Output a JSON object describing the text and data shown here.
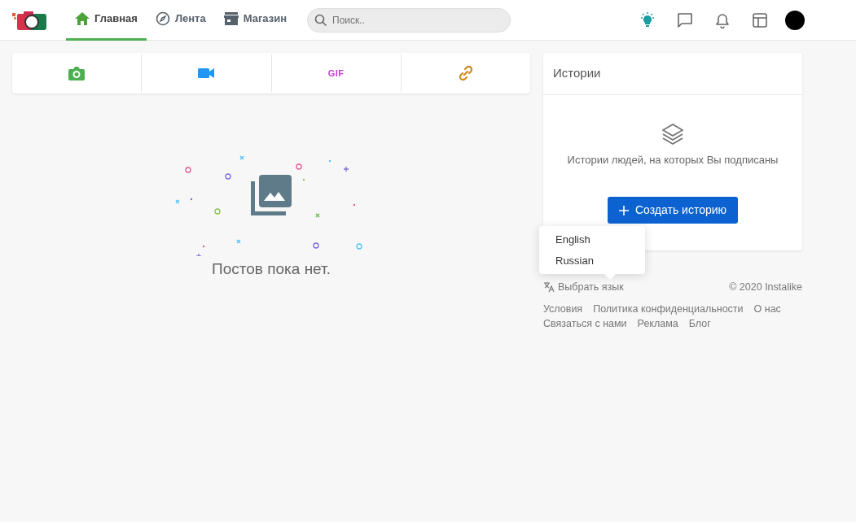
{
  "nav": {
    "tabs": [
      {
        "label": "Главная",
        "selected": true
      },
      {
        "label": "Лента",
        "selected": false
      },
      {
        "label": "Магазин",
        "selected": false
      }
    ],
    "search": {
      "placeholder": "Поиск.."
    }
  },
  "composer": [
    {
      "kind": "photo"
    },
    {
      "kind": "video"
    },
    {
      "kind": "gif",
      "label": "GIF"
    },
    {
      "kind": "link"
    }
  ],
  "feed": {
    "empty_message": "Постов пока нет."
  },
  "stories": {
    "title": "Истории",
    "hint": "Истории людей, на которых Вы подписаны",
    "button": "Создать историю"
  },
  "language_menu": {
    "options": [
      "English",
      "Russian"
    ],
    "trigger": "Выбрать язык"
  },
  "copyright": "© 2020 Instalike",
  "footer_links": [
    "Условия",
    "Политика конфиденциальности",
    "О нас",
    "Связаться с нами",
    "Реклама",
    "Блог"
  ]
}
